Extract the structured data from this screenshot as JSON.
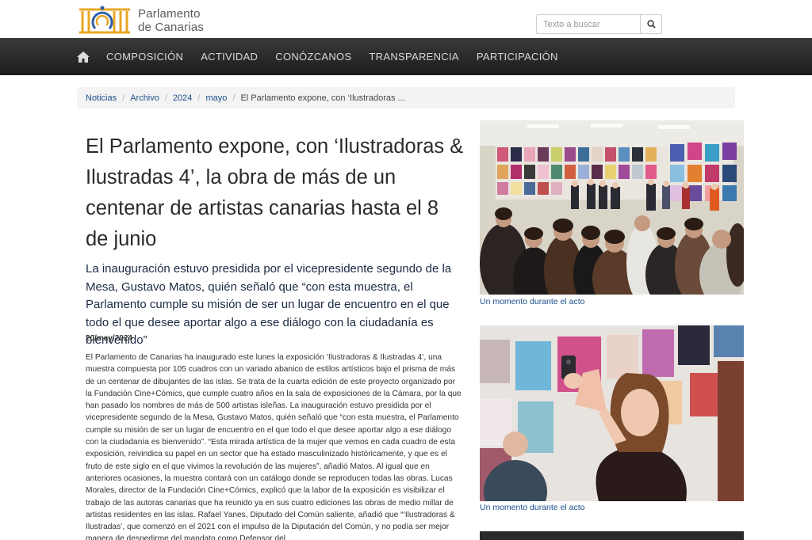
{
  "header": {
    "logo_line1": "Parlamento",
    "logo_line2": "de Canarias",
    "search_placeholder": "Texto a buscar"
  },
  "nav": {
    "home_icon": "home-icon",
    "items": [
      "COMPOSICIÓN",
      "ACTIVIDAD",
      "CONÓZCANOS",
      "TRANSPARENCIA",
      "PARTICIPACIÓN"
    ]
  },
  "breadcrumb": {
    "items": [
      "Noticias",
      "Archivo",
      "2024",
      "mayo"
    ],
    "current": "El Parlamento expone, con ‘Ilustradoras ..."
  },
  "article": {
    "title": "El Parlamento expone, con ‘Ilustradoras & Ilustradas 4’, la obra de más de un centenar de artistas canarias hasta el 8 de junio",
    "lead": "La inauguración estuvo presidida por el vicepresidente segundo de la Mesa, Gustavo Matos, quién señaló que “con esta muestra, el Parlamento cumple su misión de ser un lugar de encuentro en el que todo el que desee aportar algo a ese diálogo con la ciudadanía es bienvenido”",
    "date": "20/may/2024",
    "body": "El Parlamento de Canarias ha inaugurado este lunes la exposición ‘Ilustradoras & Ilustradas 4’, una muestra compuesta por 105 cuadros con un variado abanico de estilos artísticos bajo el prisma de más de un centenar de dibujantes de las islas. Se trata de la cuarta edición de este proyecto organizado por la Fundación Cine+Cómics, que cumple cuatro años en la sala de exposiciones de la Cámara, por la que han pasado los nombres de más de 500 artistas isleñas. La inauguración estuvo presidida por el vicepresidente segundo de la Mesa, Gustavo Matos, quién señaló que “con esta muestra, el Parlamento cumple su misión de ser un lugar de encuentro en el que todo el que desee aportar algo a ese diálogo con la ciudadanía es bienvenido”. “Esta mirada artística de la mujer que vemos en cada cuadro de esta exposición, reivindica su papel en un sector que ha estado masculinizado históricamente, y que es el fruto de este siglo en el que vivimos la revolución de las mujeres”, añadió Matos. Al igual que en anteriores ocasiones, la muestra contará con un catálogo donde se reproducen todas las obras. Lucas Morales, director de la Fundación Cine+Cómics, explicó que la labor de la exposición es visibilizar el trabajo de las autoras canarias que ha reunido ya en sus cuatro ediciones las obras de medio millar de artistas residentes en las islas. Rafael Yanes, Diputado del Común saliente, añadió que “‘Ilustradoras & Ilustradas’, que comenzó en el 2021 con el impulso de la Diputación del Común, y no podía ser mejor manera de despedirme del mandato como Defensor del"
  },
  "photos": {
    "caption1": "Un momento durante el acto",
    "caption2": "Un momento durante el acto"
  },
  "colors": {
    "link": "#1a4e8a",
    "logo_gold": "#e8a623",
    "logo_blue": "#2d5fa8"
  }
}
